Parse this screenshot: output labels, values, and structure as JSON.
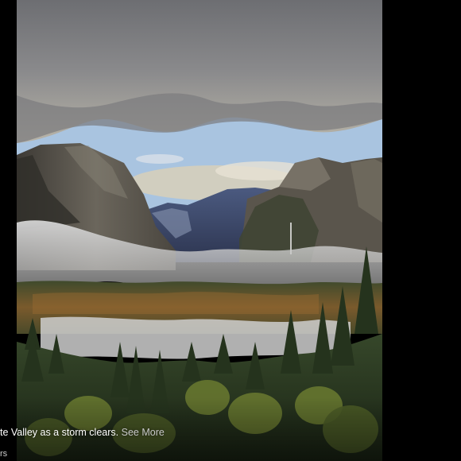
{
  "photo": {
    "description_icon": "landscape-photo"
  },
  "caption": {
    "text": "te Valley as a storm clears.",
    "see_more": "See More"
  },
  "subline": {
    "text": "rs"
  },
  "colors": {
    "background": "#000000",
    "caption_text": "#ffffff",
    "link_text": "#c9c9c9"
  }
}
